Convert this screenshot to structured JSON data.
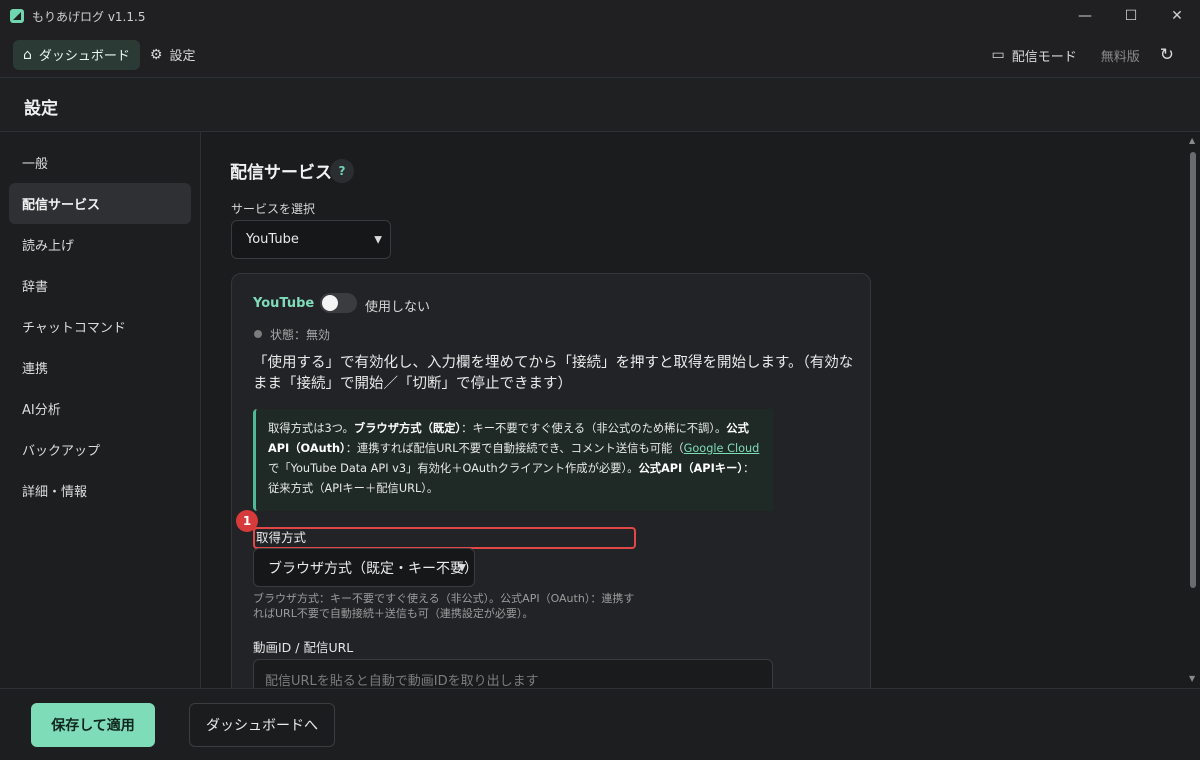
{
  "app": {
    "title": "もりあげログ v1.1.5"
  },
  "window_controls": {
    "minimize": "—",
    "maximize": "☐",
    "close": "✕"
  },
  "topnav": {
    "dashboard": "ダッシュボード",
    "settings": "設定",
    "stream_mode": "配信モード",
    "plan": "無料版"
  },
  "page": {
    "title": "設定"
  },
  "sidebar": {
    "items": [
      {
        "label": "一般"
      },
      {
        "label": "配信サービス"
      },
      {
        "label": "読み上げ"
      },
      {
        "label": "辞書"
      },
      {
        "label": "チャットコマンド"
      },
      {
        "label": "連携"
      },
      {
        "label": "AI分析"
      },
      {
        "label": "バックアップ"
      },
      {
        "label": "詳細・情報"
      }
    ]
  },
  "main": {
    "section_title": "配信サービス",
    "help": "?",
    "service_label": "サービスを選択",
    "service_value": "YouTube",
    "card": {
      "service_name": "YouTube",
      "toggle_label": "使用しない",
      "status": "状態：無効",
      "description": "「使用する」で有効化し、入力欄を埋めてから「接続」を押すと取得を開始します。（有効なまま「接続」で開始／「切断」で停止できます）",
      "info": {
        "p1": "取得方式は3つ。",
        "b1": "ブラウザ方式（既定）",
        "p2": "：キー不要ですぐ使える（非公式のため稀に不調）。",
        "b2": "公式API（OAuth）",
        "p3": "：連携すれば配信URL不要で自動接続でき、コメント送信も可能（",
        "link": "Google Cloud",
        "p4": "で「YouTube Data API v3」有効化＋OAuthクライアント作成が必要）。",
        "b3": "公式API（APIキー）",
        "p5": "：従来方式（APIキー＋配信URL）。"
      },
      "marker": "1",
      "method_label": "取得方式",
      "method_value": "ブラウザ方式（既定・キー不要）",
      "method_hint": "ブラウザ方式：キー不要ですぐ使える（非公式）。公式API（OAuth）：連携すればURL不要で自動接続＋送信も可（連携設定が必要）。",
      "id_label": "動画ID / 配信URL",
      "id_placeholder": "配信URLを貼ると自動で動画IDを取り出します"
    }
  },
  "footer": {
    "save": "保存して適用",
    "to_dashboard": "ダッシュボードへ"
  },
  "colors": {
    "accent": "#7fdcb9",
    "highlight": "#e04848"
  }
}
